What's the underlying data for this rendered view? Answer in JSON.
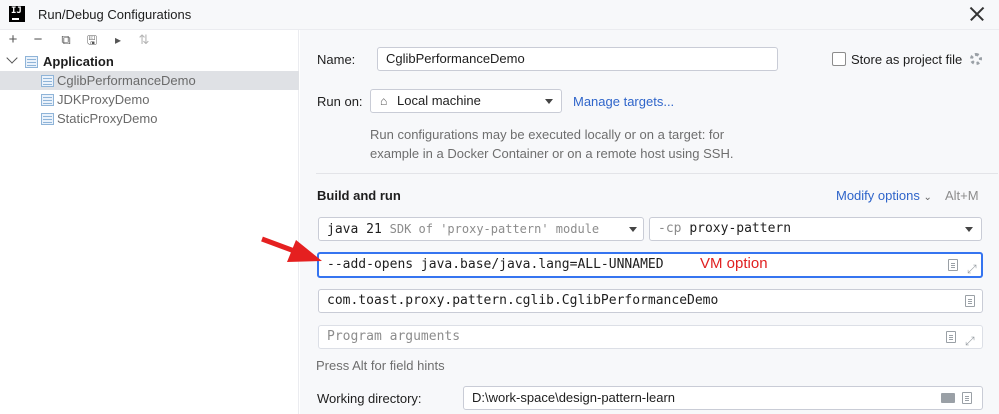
{
  "window": {
    "title": "Run/Debug Configurations"
  },
  "toolbar": {
    "add": "+",
    "remove": "−",
    "copy": "⧉",
    "save": "🖫",
    "move": "▸",
    "sort": "⇅"
  },
  "tree": {
    "group": "Application",
    "items": [
      {
        "label": "CglibPerformanceDemo",
        "selected": true
      },
      {
        "label": "JDKProxyDemo",
        "selected": false
      },
      {
        "label": "StaticProxyDemo",
        "selected": false
      }
    ]
  },
  "form": {
    "name_label": "Name:",
    "name_value": "CglibPerformanceDemo",
    "store_label": "Store as project file",
    "store_checked": false,
    "runon_label": "Run on:",
    "runon_value": "Local machine",
    "manage_targets": "Manage targets...",
    "runon_desc_1": "Run configurations may be executed locally or on a target: for",
    "runon_desc_2": "example in a Docker Container or on a remote host using SSH.",
    "build_title": "Build and run",
    "modify_options": "Modify options",
    "modify_shortcut": "Alt+M",
    "jdk_prefix": "java 21",
    "jdk_suffix": "SDK of 'proxy-pattern' module",
    "cp_prefix": "-cp",
    "cp_value": "proxy-pattern",
    "vm_options": "--add-opens java.base/java.lang=ALL-UNNAMED",
    "vm_annotation": "VM option",
    "main_class": "com.toast.proxy.pattern.cglib.CglibPerformanceDemo",
    "program_args_placeholder": "Program arguments",
    "field_hint": "Press Alt for field hints",
    "workdir_label": "Working directory:",
    "workdir_value": "D:\\work-space\\design-pattern-learn"
  },
  "colors": {
    "accent": "#3574f0",
    "link": "#2f65ca",
    "annotation": "#e02020",
    "selection": "#dfe1e5"
  }
}
